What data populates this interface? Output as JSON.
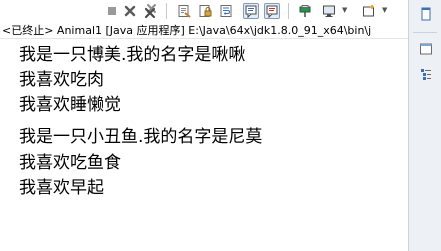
{
  "toolbar": {
    "icons": [
      "terminate-square-icon",
      "remove-launch-x-icon",
      "remove-all-terminated-icon",
      "clear-console-icon",
      "scroll-lock-icon",
      "word-wrap-icon",
      "show-on-stdout-icon",
      "show-on-stderr-icon",
      "pin-console-icon",
      "display-selected-console-icon",
      "open-console-icon"
    ]
  },
  "status": {
    "text": "<已终止> Animal1 [Java 应用程序] E:\\Java\\64x\\jdk1.8.0_91_x64\\bin\\j"
  },
  "console": {
    "lines": [
      "我是一只博美.我的名字是啾啾",
      "我喜欢吃肉",
      "我喜欢睡懒觉",
      "我是一只小丑鱼.我的名字是尼莫",
      "我喜欢吃鱼食",
      "我喜欢早起"
    ]
  },
  "colors": {
    "accent": "#2f6fb3",
    "sidebar_bg": "#edf1f6",
    "terminate_red": "#c03030"
  }
}
